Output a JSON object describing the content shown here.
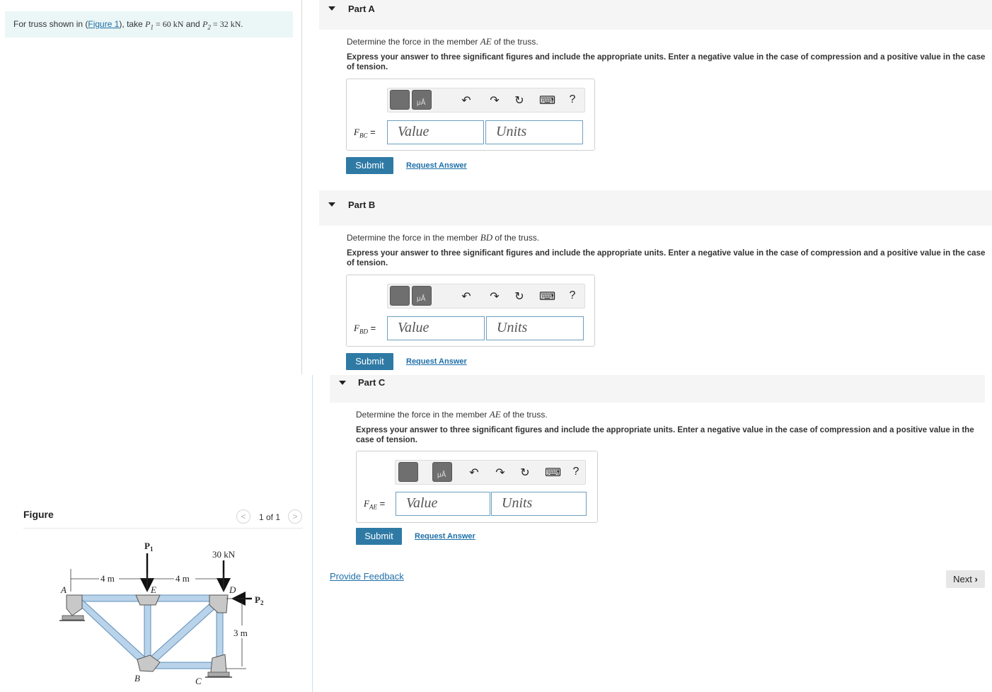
{
  "problem": {
    "prefix": "For truss shown in (",
    "figure_link": "Figure 1",
    "mid": "), take ",
    "p1_var": "P",
    "p1_sub": "1",
    "p1_val": " = 60 kN",
    "and": " and ",
    "p2_var": "P",
    "p2_sub": "2",
    "p2_val": " = 32 kN."
  },
  "figure": {
    "title": "Figure",
    "pager": "1 of 1",
    "prev": "<",
    "next": ">",
    "labels": {
      "P1": "P",
      "P1_sub": "1",
      "load30": "30 kN",
      "P2": "P",
      "P2_sub": "2",
      "dim4a": "4 m",
      "dim4b": "4 m",
      "dim3": "3 m",
      "A": "A",
      "B": "B",
      "C": "C",
      "D": "D",
      "E": "E"
    }
  },
  "parts": [
    {
      "title": "Part A",
      "question_pre": "Determine the force in the member ",
      "member": "AE",
      "question_post": " of the truss.",
      "instructions": "Express your answer to three significant figures and include the appropriate units. Enter a negative value in the case of compression and a positive value in the case of tension.",
      "var": "F",
      "var_sub": "BC",
      "eq": " =",
      "value_placeholder": "Value",
      "units_placeholder": "Units",
      "submit": "Submit",
      "request": "Request Answer"
    },
    {
      "title": "Part B",
      "question_pre": "Determine the force in the member ",
      "member": "BD",
      "question_post": " of the truss.",
      "instructions": "Express your answer to three significant figures and include the appropriate units. Enter a negative value in the case of compression and a positive value in the case of tension.",
      "var": "F",
      "var_sub": "BD",
      "eq": " =",
      "value_placeholder": "Value",
      "units_placeholder": "Units",
      "submit": "Submit",
      "request": "Request Answer"
    },
    {
      "title": "Part C",
      "question_pre": "Determine the force in the member ",
      "member": "AE",
      "question_post": " of the truss.",
      "instructions": "Express your answer to three significant figures and include the appropriate units. Enter a negative value in the case of compression and a positive value in the case of tension.",
      "var": "F",
      "var_sub": "AE",
      "eq": " =",
      "value_placeholder": "Value",
      "units_placeholder": "Units",
      "submit": "Submit",
      "request": "Request Answer"
    }
  ],
  "toolbar": {
    "undo": "↶",
    "redo": "↷",
    "reset": "↻",
    "keyboard": "⌨",
    "help": "?",
    "units_glyph": "μÅ"
  },
  "footer": {
    "feedback": "Provide Feedback",
    "next": "Next",
    "next_icon": "›"
  }
}
